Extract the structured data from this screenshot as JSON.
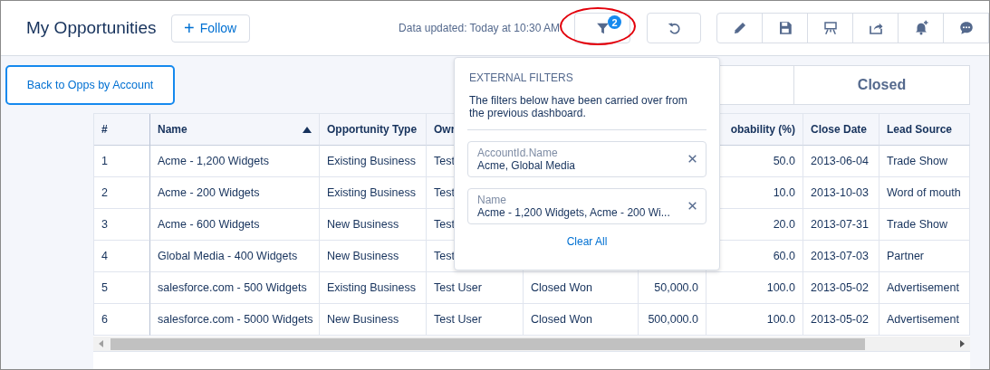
{
  "header": {
    "title": "My Opportunities",
    "follow_button": {
      "icon": "+",
      "label": "Follow"
    },
    "data_updated": "Data updated: Today at 10:30 AM",
    "filter_badge": "2"
  },
  "back_button": "Back to Opps by Account",
  "status_tiles": [
    {
      "label": "Closed"
    }
  ],
  "table": {
    "columns": [
      {
        "label": "#"
      },
      {
        "label": "Name",
        "sort_ascending": true
      },
      {
        "label": "Opportunity Type"
      },
      {
        "label": "Owr"
      },
      {},
      {},
      {
        "label": "obability (%)"
      },
      {
        "label": "Close Date"
      },
      {
        "label": "Lead Source"
      }
    ],
    "rows": [
      [
        "1",
        "Acme - 1,200 Widgets",
        "Existing Business",
        "Test",
        null,
        null,
        "50.0",
        "2013-06-04",
        "Trade Show"
      ],
      [
        "2",
        "Acme - 200 Widgets",
        "Existing Business",
        "Test",
        null,
        null,
        "10.0",
        "2013-10-03",
        "Word of mouth"
      ],
      [
        "3",
        "Acme - 600 Widgets",
        "New Business",
        "Test",
        null,
        null,
        "20.0",
        "2013-07-31",
        "Trade Show"
      ],
      [
        "4",
        "Global Media - 400 Widgets",
        "New Business",
        "Test",
        null,
        null,
        "60.0",
        "2013-07-03",
        "Partner"
      ],
      [
        "5",
        "salesforce.com - 500 Widgets",
        "Existing Business",
        "Test User",
        "Closed Won",
        "50,000.0",
        "100.0",
        "2013-05-02",
        "Advertisement"
      ],
      [
        "6",
        "salesforce.com - 5000 Widgets",
        "New Business",
        "Test User",
        "Closed Won",
        "500,000.0",
        "100.0",
        "2013-05-02",
        "Advertisement"
      ]
    ]
  },
  "filters_popover": {
    "title": "EXTERNAL FILTERS",
    "description": "The filters below have been carried over from the previous dashboard.",
    "filters": [
      {
        "field": "AccountId.Name",
        "value": "Acme, Global Media"
      },
      {
        "field": "Name",
        "value": "Acme - 1,200 Widgets, Acme - 200 Wi..."
      }
    ],
    "clear_all": "Clear All"
  }
}
